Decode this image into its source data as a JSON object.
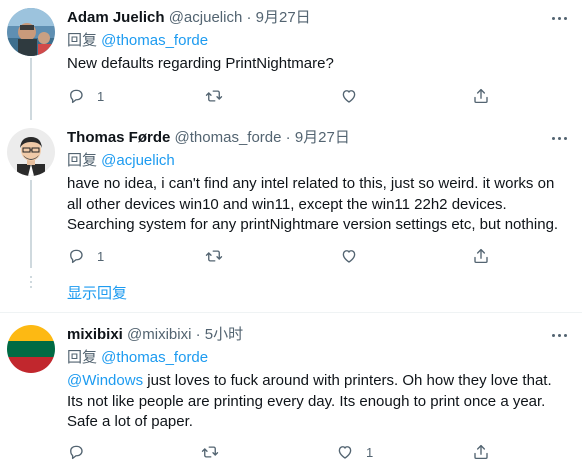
{
  "tweets": [
    {
      "name": "Adam Juelich",
      "handle": "@acjuelich",
      "dot": "·",
      "time": "9月27日",
      "reply_prefix": "回复 ",
      "reply_to": "@thomas_forde",
      "text": "New defaults regarding PrintNightmare?",
      "reply_count": "1",
      "retweet_count": "",
      "like_count": ""
    },
    {
      "name": "Thomas Førde",
      "handle": "@thomas_forde",
      "dot": "·",
      "time": "9月27日",
      "reply_prefix": "回复 ",
      "reply_to": "@acjuelich",
      "text": "have no idea, i can't find any intel related to this, just so weird. it works on\nall other devices win10 and win11, except the win11 22h2 devices.\nSearching system for any printNightmare version settings etc, but nothing.",
      "reply_count": "1",
      "retweet_count": "",
      "like_count": ""
    },
    {
      "name": "mixibixi",
      "handle": "@mixibixi",
      "dot": "·",
      "time": "5小时",
      "reply_prefix": "回复 ",
      "reply_to": "@thomas_forde",
      "text_mention": "@Windows",
      "text": " just loves to fuck around with printers. Oh how they love that.\nIts not like people are printing every day. Its enough to print once a year.\nSafe a lot of paper.",
      "reply_count": "",
      "retweet_count": "",
      "like_count": "1"
    }
  ],
  "show_replies": "显示回复",
  "icons": {
    "reply": "reply-icon",
    "retweet": "retweet-icon",
    "like": "heart-icon",
    "share": "share-icon",
    "more": "more-icon"
  },
  "colors": {
    "accent": "#1d9bf0",
    "secondary_text": "#536471",
    "primary_text": "#0f1419",
    "divider": "#eff3f4"
  }
}
